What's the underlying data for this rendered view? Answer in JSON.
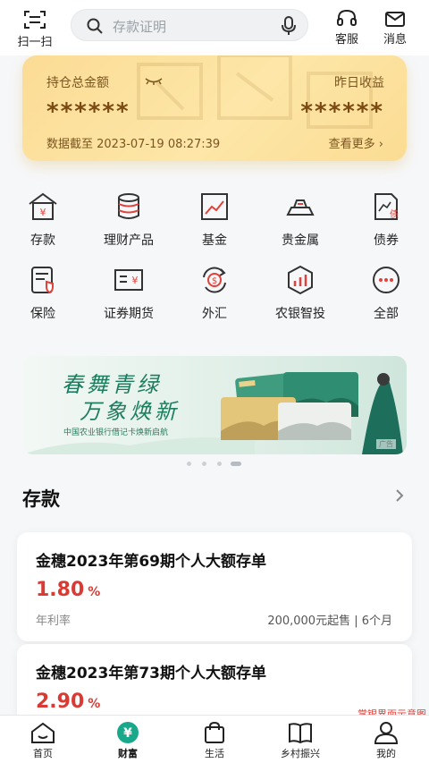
{
  "header": {
    "scan_label": "扫一扫",
    "search_placeholder": "存款证明",
    "service_label": "客服",
    "message_label": "消息"
  },
  "asset_card": {
    "total_label": "持仓总金额",
    "total_value": "******",
    "yesterday_label": "昨日收益",
    "yesterday_value": "******",
    "timestamp": "数据截至 2023-07-19 08:27:39",
    "more_label": "查看更多 ›"
  },
  "grid": {
    "items": [
      {
        "label": "存款",
        "icon": "deposit-icon"
      },
      {
        "label": "理财产品",
        "icon": "wealth-product-icon"
      },
      {
        "label": "基金",
        "icon": "fund-icon"
      },
      {
        "label": "贵金属",
        "icon": "precious-metal-icon"
      },
      {
        "label": "债券",
        "icon": "bond-icon"
      },
      {
        "label": "保险",
        "icon": "insurance-icon"
      },
      {
        "label": "证券期货",
        "icon": "securities-icon"
      },
      {
        "label": "外汇",
        "icon": "forex-icon"
      },
      {
        "label": "农银智投",
        "icon": "smart-invest-icon"
      },
      {
        "label": "全部",
        "icon": "more-icon"
      }
    ]
  },
  "banner": {
    "headline_1": "春舞青绿",
    "headline_2": "万象焕新",
    "subtitle": "中国农业银行借记卡焕新启航",
    "ad_tag": "广告"
  },
  "carousel": {
    "count": 4,
    "active_index": 3
  },
  "deposit_section": {
    "title": "存款",
    "products": [
      {
        "name": "金穗2023年第69期个人大额存单",
        "rate": "1.80",
        "rate_unit": "%",
        "rate_label": "年利率",
        "info": "200,000元起售 | 6个月"
      },
      {
        "name": "金穗2023年第73期个人大额存单",
        "rate": "2.90",
        "rate_unit": "%"
      }
    ]
  },
  "watermark": "掌银界面示意图",
  "tabbar": {
    "tabs": [
      {
        "label": "首页",
        "icon": "home-icon"
      },
      {
        "label": "财富",
        "icon": "wealth-icon"
      },
      {
        "label": "生活",
        "icon": "shopping-bag-icon"
      },
      {
        "label": "乡村振兴",
        "icon": "book-icon"
      },
      {
        "label": "我的",
        "icon": "user-icon"
      }
    ],
    "active_index": 1
  },
  "colors": {
    "accent_green": "#1aa88a",
    "rate_red": "#d93b34",
    "card_gold": "#fbdc95"
  }
}
